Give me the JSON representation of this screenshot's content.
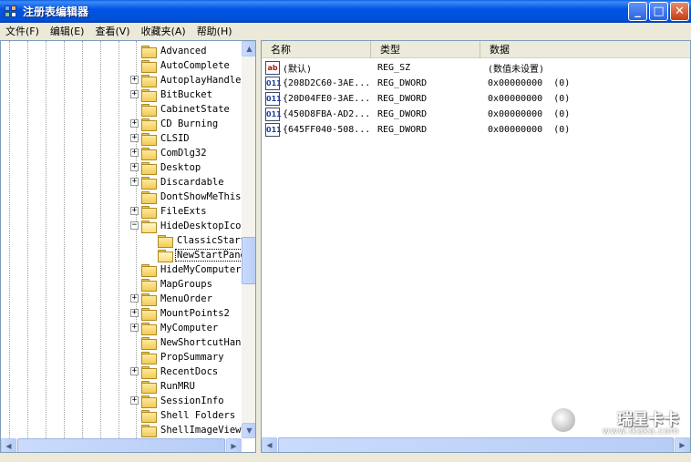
{
  "window": {
    "title": "注册表编辑器"
  },
  "window_buttons": {
    "minimize": "_",
    "maximize": "□",
    "close": "✕"
  },
  "menu": [
    "文件(F)",
    "编辑(E)",
    "查看(V)",
    "收藏夹(A)",
    "帮助(H)"
  ],
  "tree": {
    "items": [
      {
        "label": "Advanced",
        "expander": ""
      },
      {
        "label": "AutoComplete",
        "expander": ""
      },
      {
        "label": "AutoplayHandlers",
        "expander": "+"
      },
      {
        "label": "BitBucket",
        "expander": "+"
      },
      {
        "label": "CabinetState",
        "expander": ""
      },
      {
        "label": "CD Burning",
        "expander": "+"
      },
      {
        "label": "CLSID",
        "expander": "+"
      },
      {
        "label": "ComDlg32",
        "expander": "+"
      },
      {
        "label": "Desktop",
        "expander": "+"
      },
      {
        "label": "Discardable",
        "expander": "+"
      },
      {
        "label": "DontShowMeThisDialogAgain",
        "expander": ""
      },
      {
        "label": "FileExts",
        "expander": "+"
      },
      {
        "label": "HideDesktopIcons",
        "expander": "−"
      },
      {
        "label": "ClassicStartMenu",
        "expander": ""
      },
      {
        "label": "NewStartPanel",
        "expander": ""
      },
      {
        "label": "HideMyComputerIcons",
        "expander": ""
      },
      {
        "label": "MapGroups",
        "expander": ""
      },
      {
        "label": "MenuOrder",
        "expander": "+"
      },
      {
        "label": "MountPoints2",
        "expander": "+"
      },
      {
        "label": "MyComputer",
        "expander": "+"
      },
      {
        "label": "NewShortcutHandlers",
        "expander": ""
      },
      {
        "label": "PropSummary",
        "expander": ""
      },
      {
        "label": "RecentDocs",
        "expander": "+"
      },
      {
        "label": "RunMRU",
        "expander": ""
      },
      {
        "label": "SessionInfo",
        "expander": "+"
      },
      {
        "label": "Shell Folders",
        "expander": ""
      },
      {
        "label": "ShellImageView",
        "expander": ""
      }
    ]
  },
  "list": {
    "headers": {
      "name": "名称",
      "type": "类型",
      "data": "数据"
    },
    "rows": [
      {
        "icon": "ab",
        "kind": "sz",
        "name": "(默认)",
        "type": "REG_SZ",
        "data": "(数值未设置)"
      },
      {
        "icon": "011",
        "kind": "dw",
        "name": "{208D2C60-3AE...",
        "type": "REG_DWORD",
        "data": "0x00000000  (0)"
      },
      {
        "icon": "011",
        "kind": "dw",
        "name": "{20D04FE0-3AE...",
        "type": "REG_DWORD",
        "data": "0x00000000  (0)"
      },
      {
        "icon": "011",
        "kind": "dw",
        "name": "{450D8FBA-AD2...",
        "type": "REG_DWORD",
        "data": "0x00000000  (0)"
      },
      {
        "icon": "011",
        "kind": "dw",
        "name": "{645FF040-508...",
        "type": "REG_DWORD",
        "data": "0x00000000  (0)"
      }
    ]
  },
  "scrollbar_arrows": {
    "up": "▲",
    "down": "▼",
    "left": "◀",
    "right": "▶"
  },
  "watermark": {
    "brand": "瑞星卡卡",
    "url": "www.ikaka.com"
  },
  "colors": {
    "title_bar": "#0054e3",
    "selection": "#316ac5",
    "pane_border": "#7f9db9"
  }
}
